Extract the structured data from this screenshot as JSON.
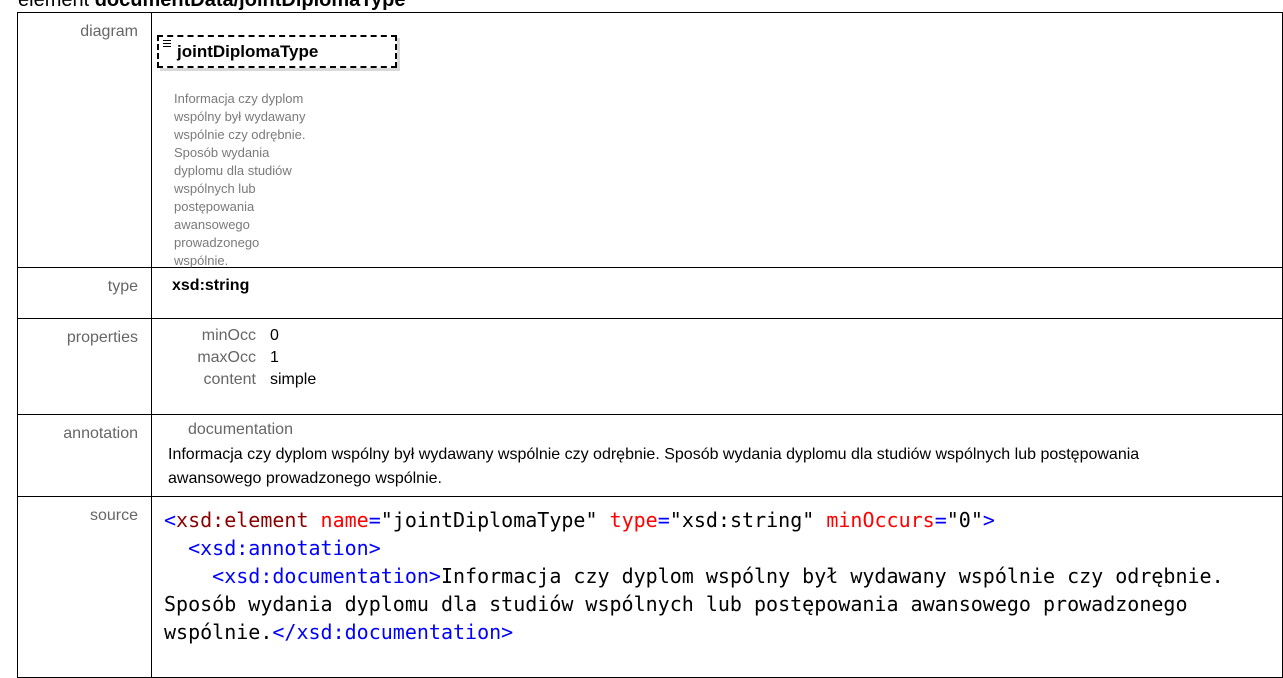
{
  "heading": {
    "prefix": "element",
    "name": "documentData/jointDiplomaType"
  },
  "rows": {
    "diagram_label": "diagram",
    "type_label": "type",
    "properties_label": "properties",
    "annotation_label": "annotation",
    "source_label": "source"
  },
  "diagram": {
    "element_name": "jointDiplomaType",
    "description": "Informacja czy dyplom wspólny był wydawany wspólnie czy odrębnie. Sposób wydania dyplomu dla studiów wspólnych lub postępowania awansowego prowadzonego wspólnie."
  },
  "type": "xsd:string",
  "properties": [
    {
      "key": "minOcc",
      "value": "0"
    },
    {
      "key": "maxOcc",
      "value": "1"
    },
    {
      "key": "content",
      "value": "simple"
    }
  ],
  "annotation": {
    "heading": "documentation",
    "text": "Informacja czy dyplom wspólny był wydawany wspólnie czy odrębnie. Sposób wydania dyplomu dla studiów wspólnych lub postępowania awansowego prowadzonego wspólnie."
  },
  "source": {
    "open_bracket": "<",
    "tag": "xsd:element",
    "attr1_name": "name",
    "attr1_value": "\"jointDiplomaType\"",
    "attr2_name": "type",
    "attr2_value": "\"xsd:string\"",
    "attr3_name": "minOccurs",
    "attr3_value": "\"0\"",
    "close_bracket": ">",
    "annotation_tag": "<xsd:annotation>",
    "documentation_open": "<xsd:documentation>",
    "documentation_text": "Informacja czy dyplom wspólny był wydawany wspólnie czy odrębnie. Sposób wydania dyplomu dla studiów wspólnych lub postępowania awansowego prowadzonego wspólnie.",
    "documentation_close": "</xsd:documentation>"
  },
  "colors": {
    "tag": "#0000ff",
    "name": "#8b0000",
    "attr": "#ff0000",
    "label": "#666666"
  }
}
